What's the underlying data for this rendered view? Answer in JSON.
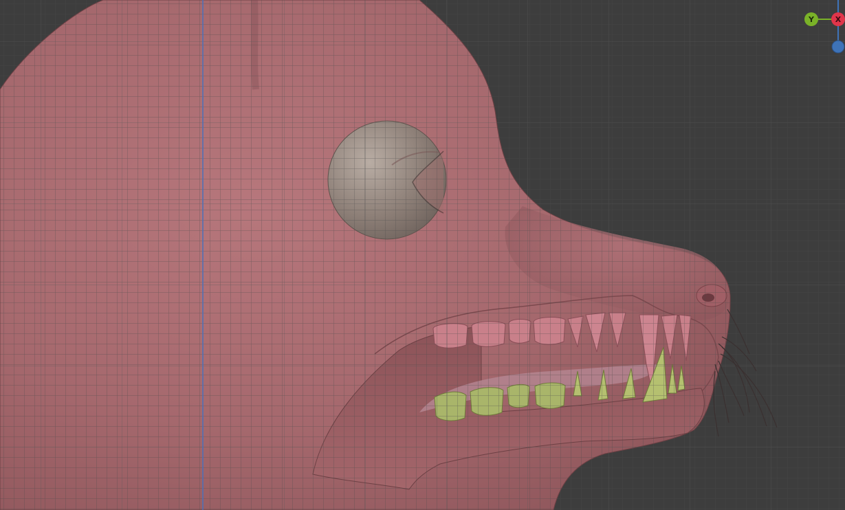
{
  "viewport": {
    "background": "#3d3d3d",
    "grid_minor": "#4a4a4a",
    "grid_major": "#555555",
    "axis_line_color": "#4d70b8"
  },
  "model": {
    "skin_color": "#a86a6f",
    "eye_color": "#8f8078",
    "upper_teeth_color": "#c9808a",
    "lower_teeth_color": "#a9b56a"
  },
  "gizmo": {
    "y_label": "Y",
    "x_label": "X",
    "y_color": "#7ab228",
    "x_color": "#e0354a",
    "z_color": "#3e73b8"
  }
}
